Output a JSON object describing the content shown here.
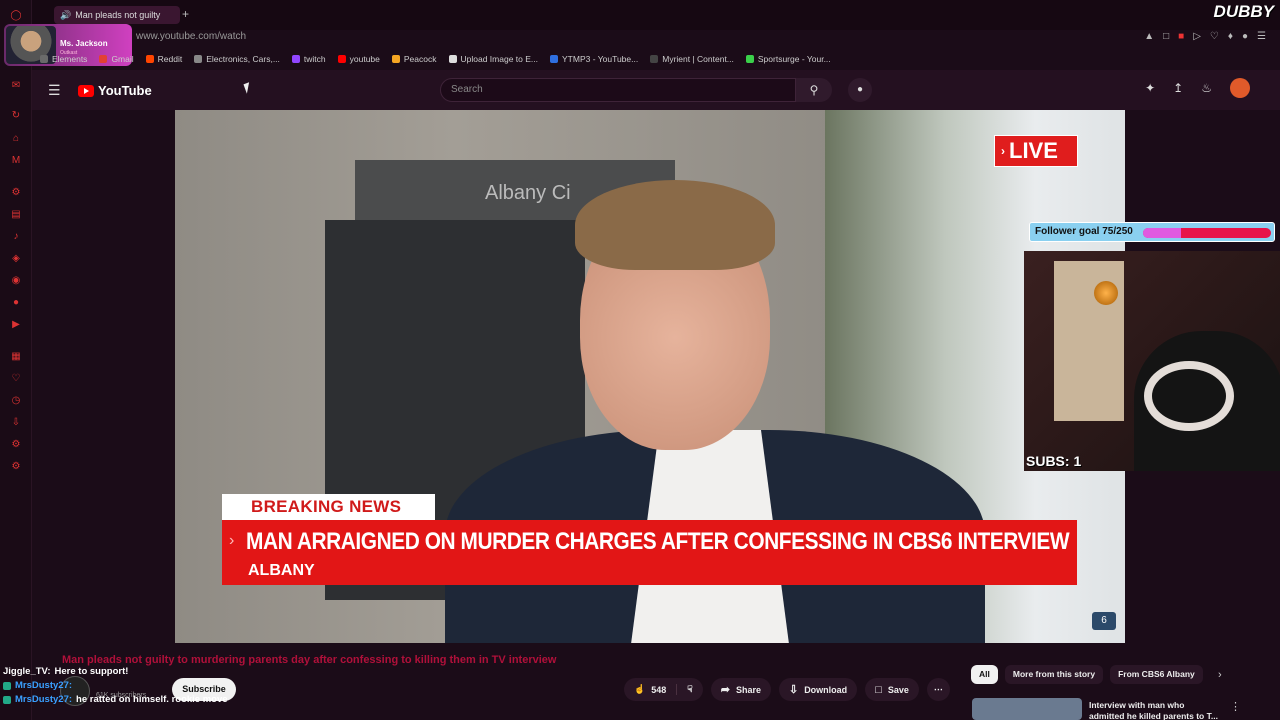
{
  "browser": {
    "tab_title": "Man pleads not guilty",
    "url": "www.youtube.com/watch",
    "brand": "DUBBY",
    "profile": {
      "name": "Ms. Jackson",
      "status": "Outkast"
    },
    "bookmarks": [
      {
        "label": "Elements",
        "color": "#6a6a6a"
      },
      {
        "label": "Gmail",
        "color": "#e34133"
      },
      {
        "label": "Reddit",
        "color": "#ff4500"
      },
      {
        "label": "Electronics, Cars,...",
        "color": "#888888"
      },
      {
        "label": "twitch",
        "color": "#9146ff"
      },
      {
        "label": "youtube",
        "color": "#ff0000"
      },
      {
        "label": "Peacock",
        "color": "#f5a623"
      },
      {
        "label": "Upload Image to E...",
        "color": "#dddddd"
      },
      {
        "label": "YTMP3 - YouTube...",
        "color": "#2f6fe0"
      },
      {
        "label": "Myrient | Content...",
        "color": "#444444"
      },
      {
        "label": "Sportsurge - Your...",
        "color": "#3ad04a"
      }
    ]
  },
  "youtube": {
    "logo": "YouTube",
    "search_placeholder": "Search"
  },
  "video": {
    "live_label": "LIVE",
    "sign_text": "Albany Ci",
    "lower_third_tag": "BREAKING NEWS",
    "lower_third_headline": "MAN ARRAIGNED ON MURDER CHARGES AFTER CONFESSING IN CBS6 INTERVIEW",
    "lower_third_location": "ALBANY",
    "network_bug": "6",
    "title": "Man pleads not guilty to murdering parents day after confessing to killing them in TV interview"
  },
  "overlay": {
    "follower_goal": "Follower goal 75/250",
    "follower_progress": 0.3,
    "subs": "SUBS: 1"
  },
  "chat": [
    {
      "user": "Jiggle_TV:",
      "message": "Here to support!"
    },
    {
      "user": "MrsDusty27:",
      "message": ""
    },
    {
      "user": "MrsDusty27:",
      "message": "he ratted on himself. rookie move"
    }
  ],
  "channel": {
    "subscribers": "61K subscribers",
    "subscribe_label": "Subscribe"
  },
  "actions": {
    "likes": "548",
    "share": "Share",
    "download": "Download",
    "save": "Save"
  },
  "chips": [
    "All",
    "More from this story",
    "From CBS6 Albany"
  ],
  "recommendation": {
    "title": "Interview with man who admitted he killed parents to T..."
  },
  "colors": {
    "live": "#e01d1d",
    "lower_third": "#e21616",
    "goal_bar": "#e8144a",
    "goal_fill": "#e05ae0"
  }
}
